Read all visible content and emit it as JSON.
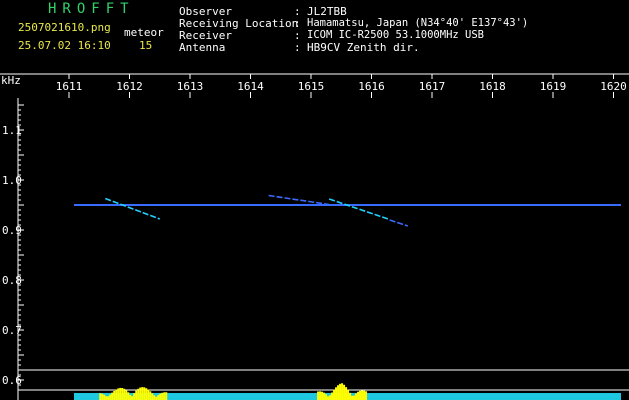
{
  "header": {
    "app_title": "HROFFT",
    "filename": "2507021610.png",
    "datetime": "25.07.02 16:10",
    "meteor_label": "meteor",
    "meteor_count": "15",
    "info": [
      {
        "label": "Observer",
        "sep": ":",
        "value": "JL2TBB"
      },
      {
        "label": "Receiving Location",
        "sep": ":",
        "value": "Hamamatsu, Japan (N34°40' E137°43')"
      },
      {
        "label": "Receiver",
        "sep": ":",
        "value": "ICOM IC-R2500 53.1000MHz USB"
      },
      {
        "label": "Antenna",
        "sep": ":",
        "value": "HB9CV Zenith dir."
      }
    ]
  },
  "axis": {
    "unit_label": "kHz",
    "time_ticks": [
      "1611",
      "1612",
      "1613",
      "1614",
      "1615",
      "1616",
      "1617",
      "1618",
      "1619",
      "1620"
    ],
    "freq_ticks": [
      "1.1",
      "1.0",
      "0.9",
      "0.8",
      "0.7",
      "0.6"
    ]
  },
  "chart_data": {
    "type": "scatter",
    "xlabel": "",
    "ylabel": "kHz",
    "x_ticks": [
      "1611",
      "1612",
      "1613",
      "1614",
      "1615",
      "1616",
      "1617",
      "1618",
      "1619",
      "1620"
    ],
    "y_ticks": [
      1.1,
      1.0,
      0.9,
      0.8,
      0.7,
      0.6
    ],
    "carrier_khz": 0.95,
    "meteor_echoes": [
      {
        "start_time": "1611.6",
        "end_time": "1612.5",
        "start_khz": 0.963,
        "end_khz": 0.922
      },
      {
        "start_time": "1615.3",
        "end_time": "1616.3",
        "start_khz": 0.962,
        "end_khz": 0.921
      },
      {
        "start_time": "1614.3",
        "end_time": "1615.3",
        "start_khz": 0.969,
        "end_khz": 0.951
      },
      {
        "start_time": "1616.3",
        "end_time": "1616.6",
        "start_khz": 0.92,
        "end_khz": 0.908
      }
    ],
    "colors": {
      "background": "#000000",
      "carrier": "#3a6bff",
      "echo": "#22d0ff",
      "activity": "#ffff00",
      "noise": "#1ec8e0",
      "text": "#ffffff"
    }
  }
}
